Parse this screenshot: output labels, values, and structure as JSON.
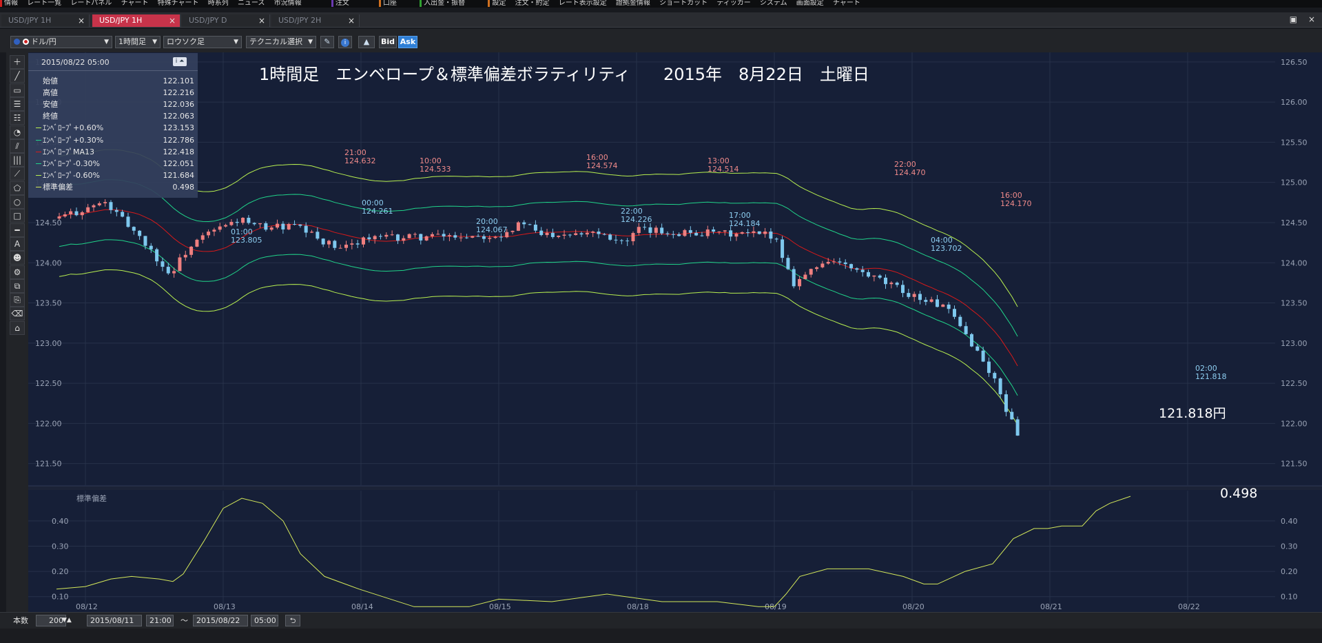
{
  "menubar": {
    "items": [
      "情報",
      "レート一覧",
      "レートパネル",
      "チャート",
      "特殊チャート",
      "時系列",
      "ニュース",
      "市況情報",
      "注文",
      "口座",
      "入出金・振替",
      "設定",
      "注文・約定",
      "レート表示設定",
      "證拠金情報",
      "ショートカット",
      "ティッカー",
      "システム",
      "画面設定",
      "チャート"
    ]
  },
  "tabs": [
    {
      "label": "USD/JPY 1H",
      "close": "×"
    },
    {
      "label": "USD/JPY 1H",
      "close": "×"
    },
    {
      "label": "USD/JPY D",
      "close": "×"
    },
    {
      "label": "USD/JPY 2H",
      "close": "×"
    }
  ],
  "toolbar": {
    "pair": "ドル/円",
    "timeframe": "1時間足",
    "chart_type": "ロウソク足",
    "technical": "テクニカル選択",
    "bid": "Bid",
    "ask": "Ask",
    "caret": "▼"
  },
  "window_controls": {
    "restore": "▣",
    "close": "×"
  },
  "datapanel": {
    "date": "2015/08/22 05:00",
    "icon": "i ⏶",
    "rows": [
      {
        "label": "始値",
        "value": "122.101",
        "color": ""
      },
      {
        "label": "高値",
        "value": "122.216",
        "color": ""
      },
      {
        "label": "安値",
        "value": "122.036",
        "color": ""
      },
      {
        "label": "終値",
        "value": "122.063",
        "color": ""
      },
      {
        "label": "ｴﾝﾍﾞﾛｰﾌﾟ+0.60%",
        "value": "123.153",
        "color": "#b8f050"
      },
      {
        "label": "ｴﾝﾍﾞﾛｰﾌﾟ+0.30%",
        "value": "122.786",
        "color": "#20d48a"
      },
      {
        "label": "ｴﾝﾍﾞﾛｰﾌﾟMA13",
        "value": "122.418",
        "color": "#d81a1a"
      },
      {
        "label": "ｴﾝﾍﾞﾛｰﾌﾟ-0.30%",
        "value": "122.051",
        "color": "#20d48a"
      },
      {
        "label": "ｴﾝﾍﾞﾛｰﾌﾟ-0.60%",
        "value": "121.684",
        "color": "#b8f050"
      },
      {
        "label": "標準偏差",
        "value": "0.498",
        "color": "#d4e85a"
      }
    ]
  },
  "chart_data": {
    "type": "candlestick",
    "title": "1時間足　エンベロープ＆標準偏差ボラティリティ　　2015年　8月22日　土曜日",
    "y_ticks": [
      "126.50",
      "126.00",
      "125.50",
      "125.00",
      "124.50",
      "124.00",
      "123.50",
      "123.00",
      "122.50",
      "122.00",
      "121.50"
    ],
    "ylim": [
      121.3,
      126.55
    ],
    "x_labels": [
      "08/12",
      "08/13",
      "08/14",
      "08/15",
      "08/18",
      "08/19",
      "08/20",
      "08/21",
      "08/22"
    ],
    "colors": {
      "up": "#ef7f7f",
      "down": "#7ec8ee",
      "ma": "#d81a1a",
      "env30": "#20d48a",
      "env60": "#b8f050",
      "stdev": "#d4e85a"
    },
    "annotations": [
      {
        "time": "21:00",
        "price": "124.632",
        "kind": "high"
      },
      {
        "time": "10:00",
        "price": "124.533",
        "kind": "high"
      },
      {
        "time": "16:00",
        "price": "124.574",
        "kind": "high"
      },
      {
        "time": "13:00",
        "price": "124.514",
        "kind": "high"
      },
      {
        "time": "22:00",
        "price": "124.470",
        "kind": "high"
      },
      {
        "time": "16:00",
        "price": "124.170",
        "kind": "high"
      },
      {
        "time": "01:00",
        "price": "123.805",
        "kind": "low"
      },
      {
        "time": "00:00",
        "price": "124.261",
        "kind": "low"
      },
      {
        "time": "20:00",
        "price": "124.067",
        "kind": "low"
      },
      {
        "time": "22:00",
        "price": "124.226",
        "kind": "low"
      },
      {
        "time": "17:00",
        "price": "124.184",
        "kind": "low"
      },
      {
        "time": "04:00",
        "price": "123.702",
        "kind": "low"
      },
      {
        "time": "02:00",
        "price": "121.818",
        "kind": "low"
      }
    ],
    "last_price_label": "121.818円",
    "stdev_label": "0.498",
    "subpanel_title": "標準偏差",
    "stdev_ticks": [
      "0.40",
      "0.30",
      "0.20",
      "0.10"
    ],
    "stdev_ylim": [
      0.05,
      0.52
    ],
    "close_path": [
      {
        "x": "08/12",
        "y": 124.55
      },
      {
        "x": "08/12 12h",
        "y": 124.75
      },
      {
        "x": "08/12 18h",
        "y": 124.35
      },
      {
        "x": "08/13 01h",
        "y": 123.85
      },
      {
        "x": "08/13 06h",
        "y": 124.15
      },
      {
        "x": "08/13 12h",
        "y": 124.35
      },
      {
        "x": "08/13 21h",
        "y": 124.55
      },
      {
        "x": "08/14",
        "y": 124.45
      },
      {
        "x": "08/14 10h",
        "y": 124.45
      },
      {
        "x": "08/14 20h",
        "y": 124.15
      },
      {
        "x": "08/15",
        "y": 124.3
      },
      {
        "x": "08/17 12h",
        "y": 124.35
      },
      {
        "x": "08/17 16h",
        "y": 124.5
      },
      {
        "x": "08/17 22h",
        "y": 124.35
      },
      {
        "x": "08/18 12h",
        "y": 124.4
      },
      {
        "x": "08/18 17h",
        "y": 124.25
      },
      {
        "x": "08/19",
        "y": 124.4
      },
      {
        "x": "08/19 18h",
        "y": 124.35
      },
      {
        "x": "08/20",
        "y": 124.35
      },
      {
        "x": "08/20 04h",
        "y": 123.75
      },
      {
        "x": "08/20 12h",
        "y": 123.95
      },
      {
        "x": "08/20 16h",
        "y": 124.05
      },
      {
        "x": "08/21",
        "y": 123.6
      },
      {
        "x": "08/21 12h",
        "y": 123.45
      },
      {
        "x": "08/21 18h",
        "y": 123.0
      },
      {
        "x": "08/22",
        "y": 122.5
      },
      {
        "x": "08/22 02h",
        "y": 121.85
      },
      {
        "x": "08/22 05h",
        "y": 122.06
      }
    ]
  },
  "statusbar": {
    "count_label": "本数",
    "count": "200",
    "from_date": "2015/08/11",
    "from_time": "21:00",
    "tilde": "～",
    "to_date": "2015/08/22",
    "to_time": "05:00",
    "arrows": "▼▲",
    "refresh": "⮌"
  },
  "lefttools": [
    "＋",
    "╱",
    "▭",
    "☰",
    "☷",
    "◔",
    "⫽",
    "|||",
    "⟋",
    "⬠",
    "○",
    "□",
    "━",
    "A",
    "☻",
    "⚙",
    "⧉",
    "⎘",
    "⌫",
    "⌂"
  ]
}
